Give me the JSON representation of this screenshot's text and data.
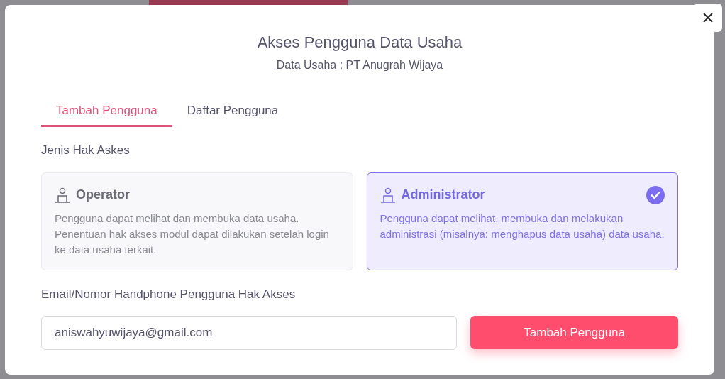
{
  "dialog": {
    "title": "Akses Pengguna Data Usaha",
    "subtitle": "Data Usaha : PT Anugrah Wijaya"
  },
  "tabs": [
    {
      "label": "Tambah Pengguna",
      "selected": true
    },
    {
      "label": "Daftar Pengguna",
      "selected": false
    }
  ],
  "access_type": {
    "label": "Jenis Hak Askes",
    "options": [
      {
        "title": "Operator",
        "description": "Pengguna dapat melihat dan membuka data usaha. Penentuan hak akses modul dapat dilakukan setelah login ke data usaha terkait.",
        "selected": false
      },
      {
        "title": "Administrator",
        "description": "Pengguna dapat melihat, membuka dan melakukan administrasi (misalnya: menghapus data usaha) data usaha.",
        "selected": true
      }
    ]
  },
  "user_field": {
    "label": "Email/Nomor Handphone Pengguna Hak Akses",
    "value": "aniswahyuwijaya@gmail.com"
  },
  "submit_button": "Tambah Pengguna"
}
